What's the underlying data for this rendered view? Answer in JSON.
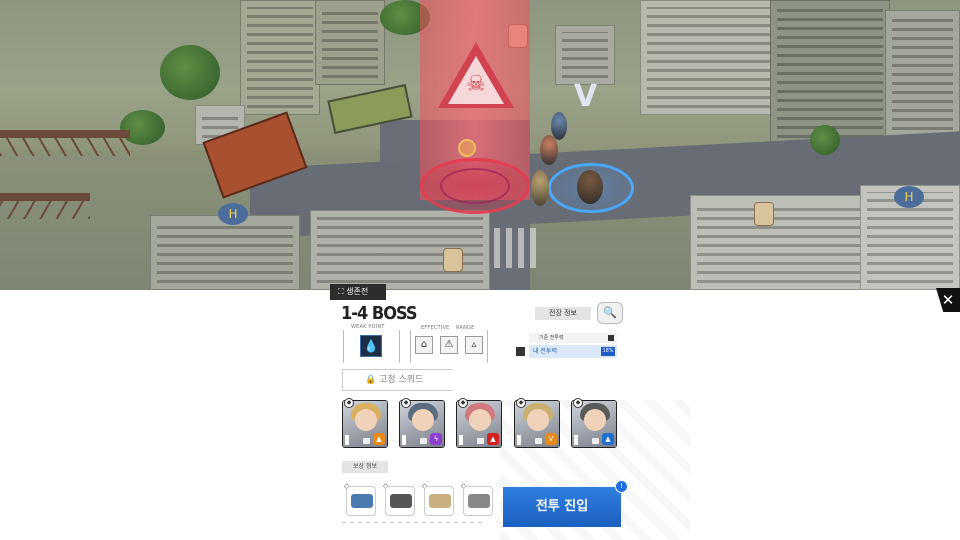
{
  "stage": {
    "area_label": "생존전",
    "name": "1-4 BOSS",
    "weak_point_label": "WEAK POINT",
    "effective_label": "EFFECTIVE",
    "range_label": "RANGE"
  },
  "combat_info": {
    "tag": "전장 정보",
    "recommended_cp_label": "기준 전투력",
    "my_cp_label": "내 전투력",
    "my_cp_value": "18%"
  },
  "fixed_squad": {
    "label": "고정 스쿼드"
  },
  "squad": {
    "cards": [
      {
        "name": "unit-1",
        "element_icon": "fire-icon",
        "element_color": "#e88a1a",
        "hair_color": "#d9b060"
      },
      {
        "name": "unit-2",
        "element_icon": "electric-icon",
        "element_color": "#8c3fd0",
        "hair_color": "#5a6d80"
      },
      {
        "name": "unit-3",
        "element_icon": "fire-icon",
        "element_color": "#d42020",
        "hair_color": "#d07a80"
      },
      {
        "name": "unit-4",
        "element_icon": "wind-icon",
        "element_color": "#e88a1a",
        "hair_color": "#c9b070"
      },
      {
        "name": "unit-5",
        "element_icon": "water-icon",
        "element_color": "#1f6fd0",
        "hair_color": "#5a5a5a"
      }
    ]
  },
  "loot": {
    "tag": "보상 정보",
    "items": [
      {
        "name": "battery-item",
        "color": "#4a7ab0"
      },
      {
        "name": "goggles-item",
        "color": "#555"
      },
      {
        "name": "mask-item",
        "color": "#c9b080"
      },
      {
        "name": "tool-item",
        "color": "#888"
      }
    ]
  },
  "enter_button": {
    "label": "전투 진입",
    "notice": "!"
  },
  "colors": {
    "accent_blue": "#1c5fc0",
    "boss_red": "#d14350"
  }
}
